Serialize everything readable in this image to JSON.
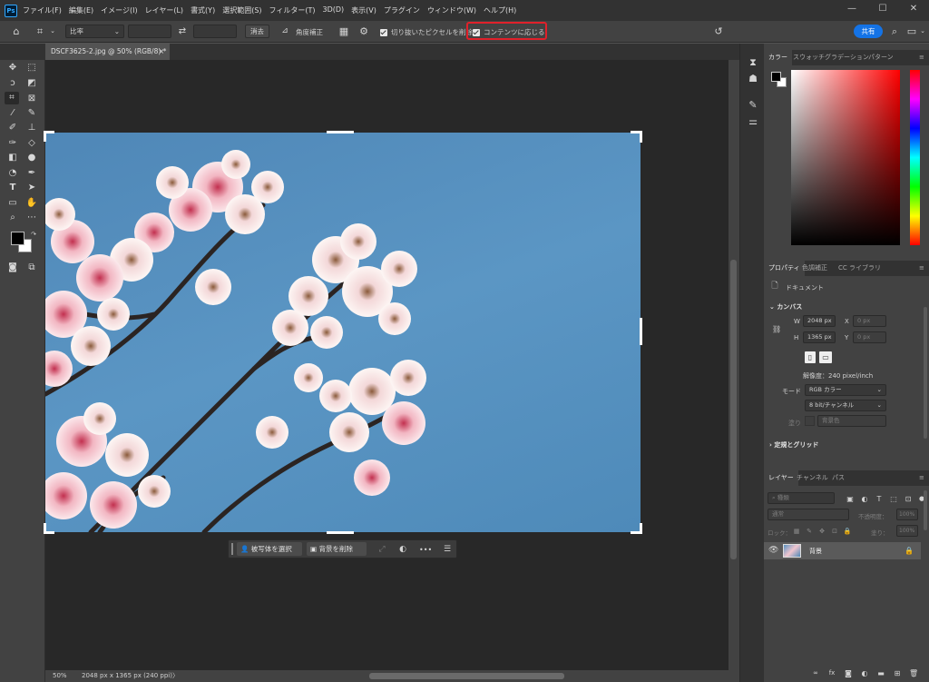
{
  "app": {
    "logo": "Ps",
    "menu": [
      "ファイル(F)",
      "編集(E)",
      "イメージ(I)",
      "レイヤー(L)",
      "書式(Y)",
      "選択範囲(S)",
      "フィルター(T)",
      "3D(D)",
      "表示(V)",
      "プラグイン",
      "ウィンドウ(W)",
      "ヘルプ(H)"
    ],
    "window_buttons": [
      "—",
      "☐",
      "✕"
    ]
  },
  "options": {
    "ratio_label": "比率",
    "width_value": "",
    "height_value": "",
    "clear_label": "消去",
    "straighten_label": "角度補正",
    "delete_cropped_label": "切り抜いたピクセルを削除",
    "content_aware_label": "コンテンツに応じる",
    "share_label": "共有"
  },
  "document": {
    "tab_title": "DSCF3625-2.jpg @ 50% (RGB/8) *",
    "tab_close": "×"
  },
  "context_bar": {
    "select_subject": "被写体を選択",
    "remove_bg": "背景を削除",
    "more": "•••"
  },
  "status": {
    "zoom": "50%",
    "doc_info": "2048 px x 1365 px (240 ppi)",
    "arrow": "〉"
  },
  "color_panel": {
    "tabs": [
      "カラー",
      "スウォッチ",
      "グラデーション",
      "パターン"
    ],
    "hue_color": "#ff0000"
  },
  "properties_panel": {
    "tabs": [
      "プロパティ",
      "色調補正",
      "CC ライブラリ"
    ],
    "doc_label": "ドキュメント",
    "canvas_section": "カンバス",
    "w_label": "W",
    "w_value": "2048 px",
    "h_label": "H",
    "h_value": "1365 px",
    "x_label": "X",
    "x_placeholder": "0 px",
    "y_label": "Y",
    "y_placeholder": "0 px",
    "resolution": "解像度：240 pixel/inch",
    "mode_label": "モード",
    "mode_value": "RGB カラー",
    "depth_value": "8 bit/チャンネル",
    "fill_label": "塗り",
    "fill_value": "背景色",
    "guides_section": "定規とグリッド"
  },
  "layers_panel": {
    "tabs": [
      "レイヤー",
      "チャンネル",
      "パス"
    ],
    "search_placeholder": "種類",
    "blend_mode": "通常",
    "opacity_label": "不透明度：",
    "opacity_value": "100%",
    "lock_label": "ロック：",
    "fill_label": "塗り：",
    "fill_value": "100%",
    "layer_name": "背景"
  }
}
